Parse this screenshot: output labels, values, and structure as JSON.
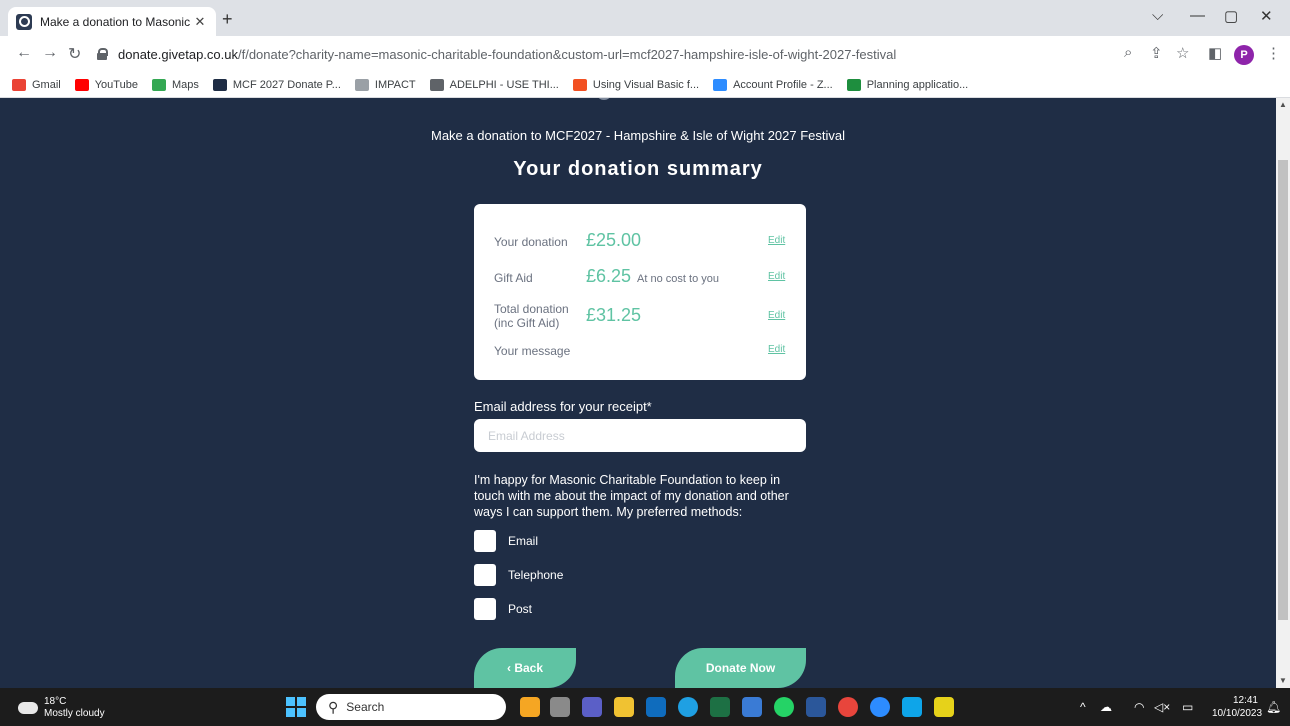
{
  "browser": {
    "tab_title": "Make a donation to Masonic Ch",
    "tab_close": "✕",
    "new_tab": "+",
    "url_domain": "donate.givetap.co.uk",
    "url_path": "/f/donate?charity-name=masonic-charitable-foundation&custom-url=mcf2027-hampshire-isle-of-wight-2027-festival",
    "profile_initial": "P",
    "bookmarks": [
      {
        "label": "Gmail",
        "color": "#ea4335"
      },
      {
        "label": "YouTube",
        "color": "#ff0000"
      },
      {
        "label": "Maps",
        "color": "#34a853"
      },
      {
        "label": "MCF 2027 Donate P...",
        "color": "#1f2d45"
      },
      {
        "label": "IMPACT",
        "color": "#9aa0a6"
      },
      {
        "label": "ADELPHI - USE THI...",
        "color": "#5f6368"
      },
      {
        "label": "Using Visual Basic f...",
        "color": "#f25022"
      },
      {
        "label": "Account Profile - Z...",
        "color": "#2d8cff"
      },
      {
        "label": "Planning applicatio...",
        "color": "#1e8e3e"
      }
    ]
  },
  "page": {
    "subtitle": "Make a donation to MCF2027 - Hampshire & Isle of Wight 2027 Festival",
    "heading": "Your donation summary",
    "summary": {
      "donation_label": "Your donation",
      "donation_amount": "£25.00",
      "gift_aid_label": "Gift Aid",
      "gift_aid_amount": "£6.25",
      "gift_aid_note": "At no cost to you",
      "total_label": "Total donation (inc Gift Aid)",
      "total_amount": "£31.25",
      "message_label": "Your message",
      "edit": "Edit"
    },
    "email_label": "Email address for your receipt*",
    "email_placeholder": "Email Address",
    "email_value": "",
    "consent_text": "I'm happy for Masonic Charitable Foundation to keep in touch with me about the impact of my donation and other ways I can support them. My preferred methods:",
    "methods": [
      "Email",
      "Telephone",
      "Post"
    ],
    "back_button": "‹ Back",
    "donate_button": "Donate Now",
    "accent_color": "#5fc3a3",
    "background_color": "#1f2d45"
  },
  "taskbar": {
    "temperature": "18°C",
    "weather": "Mostly cloudy",
    "search_placeholder": "Search",
    "time": "12:41",
    "date": "10/10/2023"
  }
}
